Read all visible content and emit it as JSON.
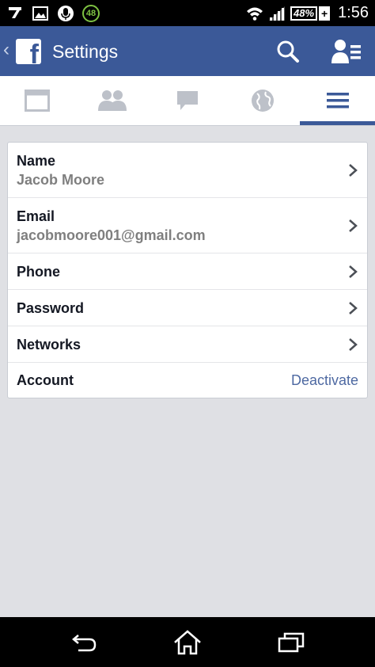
{
  "status_bar": {
    "notification_count": "48",
    "battery_percent": "48%",
    "battery_plus": "+",
    "time": "1:56"
  },
  "action_bar": {
    "back_glyph": "‹",
    "logo_letter": "f",
    "title": "Settings",
    "search_icon": "search-icon",
    "friend_requests_icon": "friend-requests-icon"
  },
  "tabs": [
    {
      "icon": "news-feed-icon",
      "active": false
    },
    {
      "icon": "friends-icon",
      "active": false
    },
    {
      "icon": "messages-icon",
      "active": false
    },
    {
      "icon": "notifications-globe-icon",
      "active": false
    },
    {
      "icon": "menu-icon",
      "active": true
    }
  ],
  "settings": {
    "rows": [
      {
        "label": "Name",
        "value": "Jacob Moore"
      },
      {
        "label": "Email",
        "value": "jacobmoore001@gmail.com"
      },
      {
        "label": "Phone"
      },
      {
        "label": "Password"
      },
      {
        "label": "Networks"
      },
      {
        "label": "Account",
        "action": "Deactivate"
      }
    ]
  },
  "colors": {
    "brand_blue": "#3b5998",
    "link_blue": "#4e69a2",
    "background": "#dfe0e4"
  }
}
